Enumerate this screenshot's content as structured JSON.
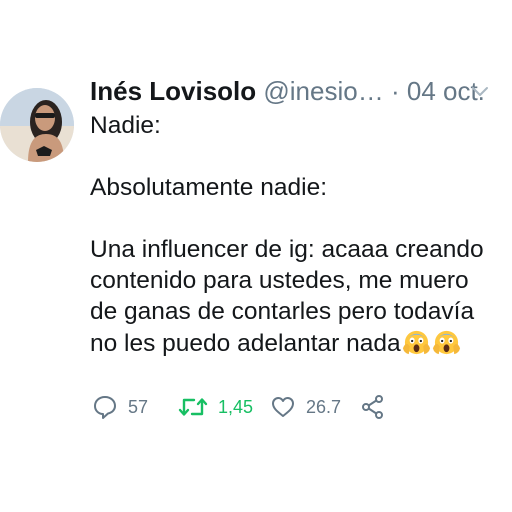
{
  "tweet": {
    "author": {
      "name": "Inés Lovisolo",
      "handle": "@inesio…",
      "separator": "·",
      "date": "04 oct."
    },
    "text": {
      "line1": "Nadie:",
      "line2": "Absolutamente nadie:",
      "line3": "Una influencer de ig: acaaa creando",
      "line4": "contenido para ustedes, me muero",
      "line5": "de ganas de contarles pero todavía",
      "line6": "no les puedo adelantar nada",
      "trailing_emoji": "screaming-in-fear-face x2"
    },
    "actions": {
      "reply_count": "57",
      "retweet_count": "1,45",
      "like_count": "26.7"
    }
  },
  "icons": {
    "reply": "speech-bubble-icon",
    "retweet": "retweet-arrows-icon",
    "like": "heart-outline-icon",
    "share": "share-nodes-icon",
    "menu": "chevron-down-icon"
  },
  "colors": {
    "text": "#14171a",
    "secondary": "#657786",
    "retweet_active": "#17bf63",
    "emoji_yellow": "#ffc83d"
  }
}
